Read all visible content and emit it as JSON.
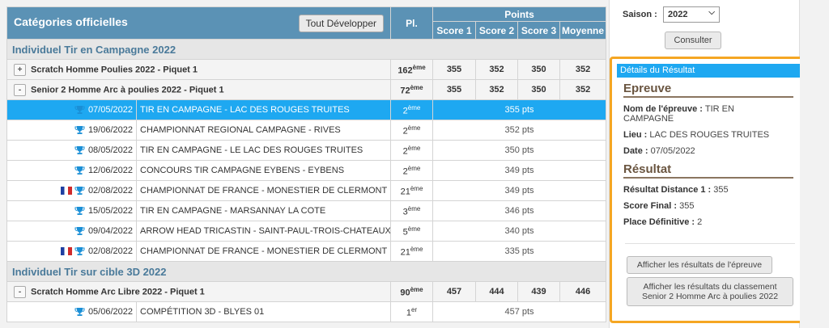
{
  "table": {
    "title": "Catégories officielles",
    "expand_button": "Tout Développer",
    "col_place": "Pl.",
    "col_points": "Points",
    "col_score1": "Score 1",
    "col_score2": "Score 2",
    "col_score3": "Score 3",
    "col_avg": "Moyenne"
  },
  "sections": [
    {
      "title": "Individuel Tir en Campagne 2022",
      "categories": [
        {
          "toggle": "+",
          "name": "Scratch Homme Poulies 2022 - Piquet 1",
          "rank": "162",
          "rank_sup": "ème",
          "s1": "355",
          "s2": "352",
          "s3": "350",
          "avg": "352"
        },
        {
          "toggle": "-",
          "name": "Senior 2 Homme Arc à poulies 2022 - Piquet 1",
          "rank": "72",
          "rank_sup": "ème",
          "s1": "355",
          "s2": "352",
          "s3": "350",
          "avg": "352"
        }
      ],
      "rows": [
        {
          "date": "07/05/2022",
          "name": "TIR EN CAMPAGNE - LAC DES ROUGES TRUITES",
          "rank": "2",
          "rank_sup": "ème",
          "pts": "355 pts",
          "selected": true,
          "flag": false
        },
        {
          "date": "19/06/2022",
          "name": "CHAMPIONNAT REGIONAL CAMPAGNE - RIVES",
          "rank": "2",
          "rank_sup": "ème",
          "pts": "352 pts",
          "selected": false,
          "flag": false
        },
        {
          "date": "08/05/2022",
          "name": "TIR EN CAMPAGNE - LE LAC DES ROUGES TRUITES",
          "rank": "2",
          "rank_sup": "ème",
          "pts": "350 pts",
          "selected": false,
          "flag": false
        },
        {
          "date": "12/06/2022",
          "name": "CONCOURS TIR CAMPAGNE EYBENS - EYBENS",
          "rank": "2",
          "rank_sup": "ème",
          "pts": "349 pts",
          "selected": false,
          "flag": false
        },
        {
          "date": "02/08/2022",
          "name": "CHAMPIONNAT DE FRANCE - MONESTIER DE CLERMONT",
          "rank": "21",
          "rank_sup": "ème",
          "pts": "349 pts",
          "selected": false,
          "flag": true
        },
        {
          "date": "15/05/2022",
          "name": "TIR EN CAMPAGNE - MARSANNAY LA COTE",
          "rank": "3",
          "rank_sup": "ème",
          "pts": "346 pts",
          "selected": false,
          "flag": false
        },
        {
          "date": "09/04/2022",
          "name": "ARROW HEAD TRICASTIN - SAINT-PAUL-TROIS-CHATEAUX",
          "rank": "5",
          "rank_sup": "ème",
          "pts": "340 pts",
          "selected": false,
          "flag": false
        },
        {
          "date": "02/08/2022",
          "name": "CHAMPIONNAT DE FRANCE - MONESTIER DE CLERMONT",
          "rank": "21",
          "rank_sup": "ème",
          "pts": "335 pts",
          "selected": false,
          "flag": true
        }
      ]
    },
    {
      "title": "Individuel Tir sur cible 3D 2022",
      "categories": [
        {
          "toggle": "-",
          "name": "Scratch Homme Arc Libre 2022 - Piquet 1",
          "rank": "90",
          "rank_sup": "ème",
          "s1": "457",
          "s2": "444",
          "s3": "439",
          "avg": "446"
        }
      ],
      "rows": [
        {
          "date": "05/06/2022",
          "name": "COMPÉTITION 3D - BLYES 01",
          "rank": "1",
          "rank_sup": "er",
          "pts": "457 pts",
          "selected": false,
          "flag": false
        }
      ]
    }
  ],
  "sidebar": {
    "season_label": "Saison :",
    "season_value": "2022",
    "consult_button": "Consulter",
    "details_title": "Détails du Résultat",
    "epreuve_heading": "Epreuve",
    "event_name_label": "Nom de l'épreuve :",
    "event_name_value": "TIR EN CAMPAGNE",
    "place_label": "Lieu :",
    "place_value": "LAC DES ROUGES TRUITES",
    "date_label": "Date :",
    "date_value": "07/05/2022",
    "result_heading": "Résultat",
    "distance_label": "Résultat Distance 1 :",
    "distance_value": "355",
    "final_label": "Score Final :",
    "final_value": "355",
    "place_def_label": "Place Définitive :",
    "place_def_value": "2",
    "btn_event_results": "Afficher les résultats de l'épreuve",
    "btn_class_results_1": "Afficher les résultats du classement",
    "btn_class_results_2": "Senior 2 Homme Arc à poulies 2022"
  },
  "colors": {
    "header": "#5b92b5",
    "selected": "#1ea8f1",
    "highlight_border": "#f5a623",
    "section_text": "#4a7a9a"
  },
  "icons": {
    "trophy": "trophy-icon",
    "flag": "france-flag-icon"
  }
}
